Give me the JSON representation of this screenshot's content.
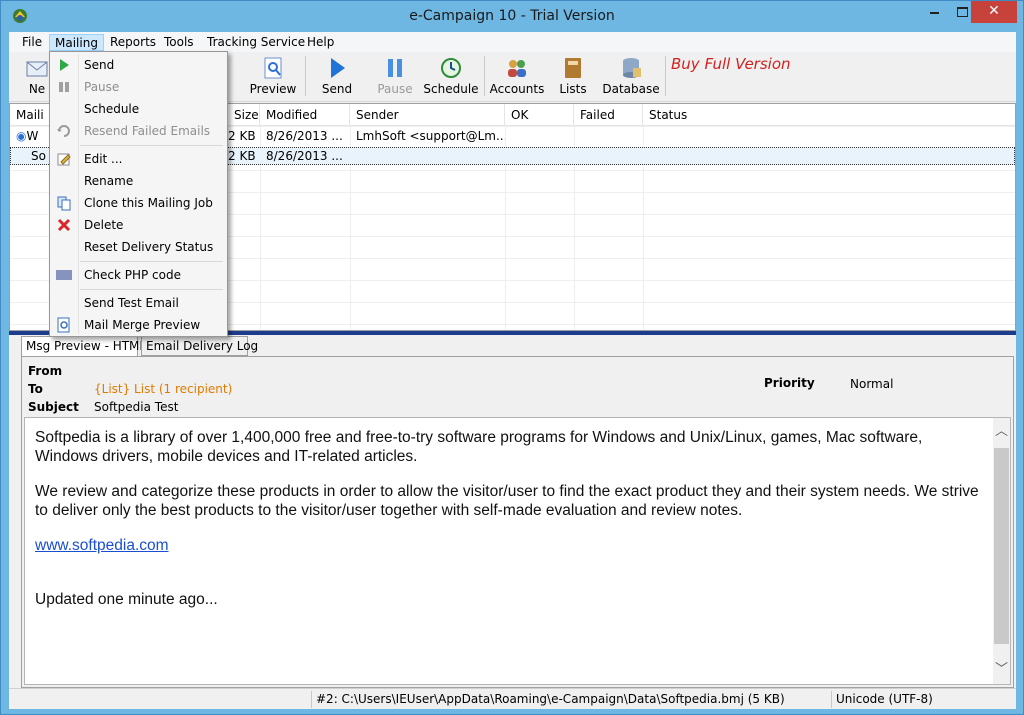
{
  "window": {
    "title": "e-Campaign 10 - Trial Version"
  },
  "menubar": {
    "items": [
      "File",
      "Mailing",
      "Reports",
      "Tools",
      "Tracking Service",
      "Help"
    ]
  },
  "toolbar": {
    "new_label": "Ne",
    "e_label": "e",
    "preview_label": "Preview",
    "send_label": "Send",
    "pause_label": "Pause",
    "schedule_label": "Schedule",
    "accounts_label": "Accounts",
    "lists_label": "Lists",
    "database_label": "Database",
    "buy_full": "Buy Full Version"
  },
  "list": {
    "columns": [
      "Maili",
      "Size",
      "Modified",
      "Sender",
      "OK",
      "Failed",
      "Status"
    ],
    "rows": [
      {
        "name": "W",
        "size": "2 KB",
        "modified": "8/26/2013 ...",
        "sender": "LmhSoft <support@Lm...",
        "ok": "",
        "failed": "",
        "status": ""
      },
      {
        "name": "So",
        "size": "2 KB",
        "modified": "8/26/2013 ...",
        "sender": "",
        "ok": "",
        "failed": "",
        "status": ""
      }
    ]
  },
  "mailing_menu": {
    "send": "Send",
    "pause": "Pause",
    "schedule": "Schedule",
    "resend_failed": "Resend Failed Emails",
    "edit": "Edit ...",
    "rename": "Rename",
    "clone": "Clone this Mailing Job",
    "delete": "Delete",
    "reset_status": "Reset Delivery Status",
    "check_php": "Check PHP code",
    "send_test": "Send Test Email",
    "mail_merge_preview": "Mail Merge Preview"
  },
  "tabs": {
    "preview_html": "Msg Preview - HTML",
    "delivery_log": "Email Delivery Log"
  },
  "preview": {
    "from_label": "From",
    "from_value": "",
    "to_label": "To",
    "to_value": "{List}  List (1 recipient)",
    "subject_label": "Subject",
    "subject_value": "Softpedia Test",
    "priority_label": "Priority",
    "priority_value": "Normal",
    "paragraph_1": "Softpedia is a library of over 1,400,000 free and free-to-try software programs for Windows and Unix/Linux, games, Mac software, Windows drivers, mobile devices and IT-related articles.",
    "paragraph_2": "We review and categorize these products in order to allow the visitor/user to find the exact product they and their system needs. We strive to deliver only the best products to the visitor/user together with self-made evaluation and review notes.",
    "link": "www.softpedia.com",
    "paragraph_3": "Updated one minute ago..."
  },
  "statusbar": {
    "path": "#2: C:\\Users\\IEUser\\AppData\\Roaming\\e-Campaign\\Data\\Softpedia.bmj  (5 KB)",
    "encoding": "Unicode (UTF-8)"
  },
  "colors": {
    "titlebar": "#6eb7e3",
    "close_button": "#c7423a",
    "buy_full": "#d42020",
    "recipient": "#e07b00",
    "splitter": "#1d3c8c",
    "link": "#1a4fd0"
  },
  "icons": {
    "app": "campaign-app-icon",
    "new": "new-mail-icon",
    "preview": "preview-icon",
    "send": "send-play-icon",
    "pause": "pause-icon",
    "schedule": "schedule-clock-icon",
    "accounts": "accounts-users-icon",
    "lists": "lists-book-icon",
    "database": "database-icon"
  }
}
